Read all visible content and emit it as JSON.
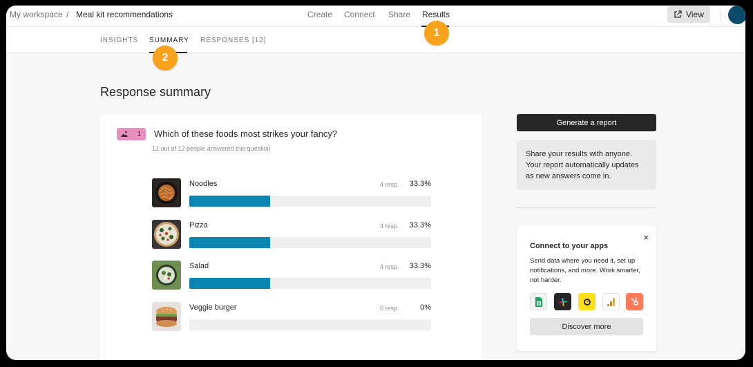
{
  "breadcrumb": {
    "workspace": "My workspace",
    "separator": "/",
    "form": "Meal kit recommendations"
  },
  "topnav": {
    "create": "Create",
    "connect": "Connect",
    "share": "Share",
    "results": "Results"
  },
  "view_button": {
    "label": "View",
    "icon": "external-link-icon"
  },
  "subtabs": {
    "insights": "INSIGHTS",
    "summary": "SUMMARY",
    "responses": "RESPONSES [12]"
  },
  "markers": {
    "one": "1",
    "two": "2"
  },
  "page_title": "Response summary",
  "question": {
    "number": "1",
    "badge_icon": "image-choice-icon",
    "badge_color": "#e98fbf",
    "title": "Which of these foods most strikes your fancy?",
    "answered": "12 out of 12 people answered this question",
    "options": [
      {
        "label": "Noodles",
        "count": "4 resp.",
        "percent": "33.3%",
        "fill": 0.333,
        "image": "noodles-image"
      },
      {
        "label": "Pizza",
        "count": "4 resp.",
        "percent": "33.3%",
        "fill": 0.333,
        "image": "pizza-image"
      },
      {
        "label": "Salad",
        "count": "4 resp.",
        "percent": "33.3%",
        "fill": 0.333,
        "image": "salad-image"
      },
      {
        "label": "Veggie burger",
        "count": "0 resp.",
        "percent": "0%",
        "fill": 0,
        "image": "veggie-burger-image"
      }
    ]
  },
  "sidebar": {
    "generate_button": "Generate a report",
    "share_text": "Share your results with anyone. Your report automatically updates as new answers come in.",
    "apps": {
      "title": "Connect to your apps",
      "description": "Send data where you need it, set up notifications, and more. Work smarter, not harder.",
      "close": "×",
      "icons": [
        "google-sheets-icon",
        "slack-icon",
        "mailchimp-icon",
        "google-analytics-icon",
        "hubspot-icon"
      ],
      "discover_button": "Discover more"
    }
  },
  "colors": {
    "bar": "#0a86b0",
    "marker": "#f6a21b",
    "avatar": "#0b4a68",
    "button_dark": "#262627"
  }
}
